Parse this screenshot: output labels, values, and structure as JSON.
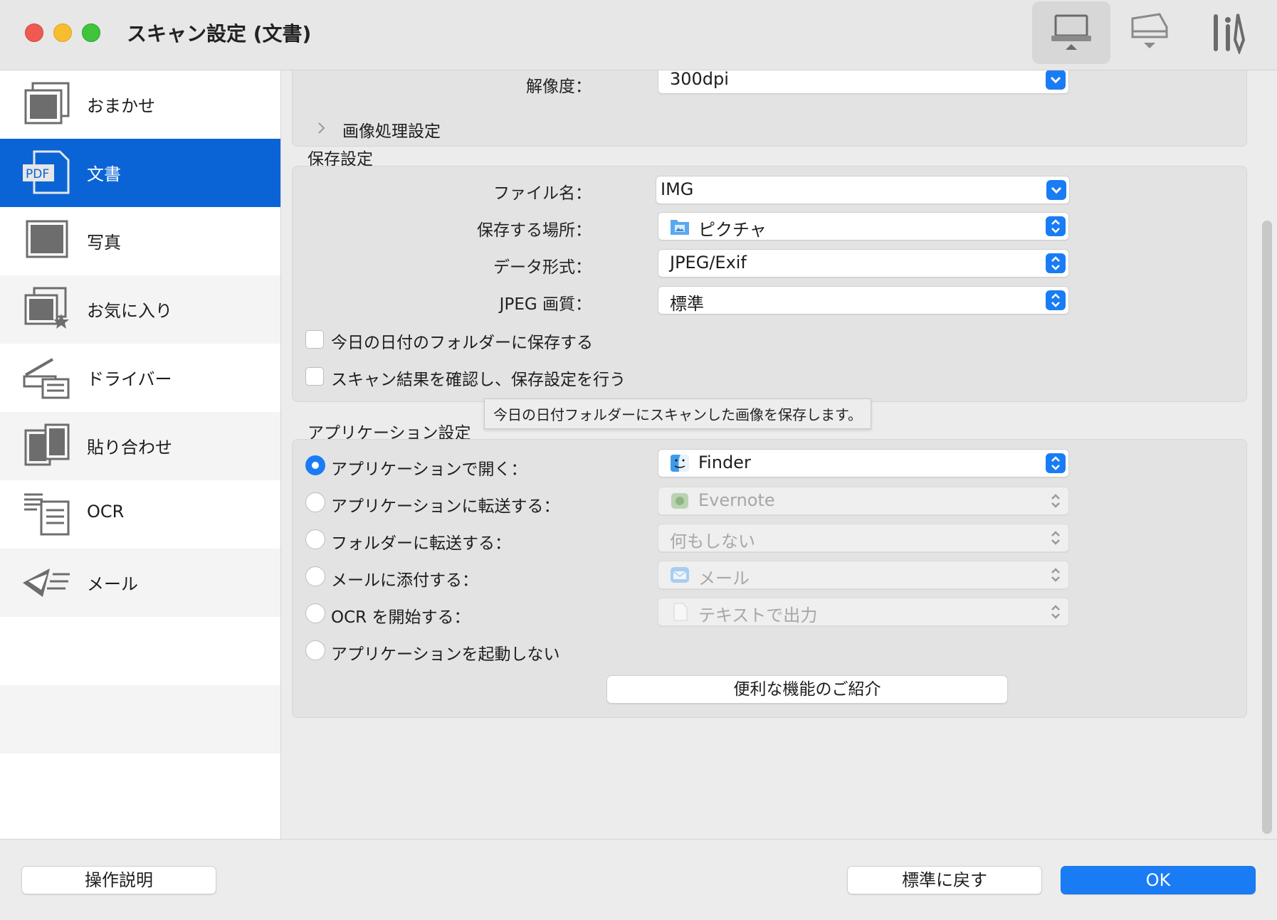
{
  "window": {
    "title": "スキャン設定 (文書)"
  },
  "toolbar": {
    "icons": [
      "computer-scan-icon",
      "scanner-scan-icon",
      "general-settings-icon"
    ]
  },
  "sidebar": {
    "items": [
      {
        "label": "おまかせ",
        "icon": "auto-scan-icon"
      },
      {
        "label": "文書",
        "icon": "pdf-document-icon",
        "selected": true
      },
      {
        "label": "写真",
        "icon": "photo-icon"
      },
      {
        "label": "お気に入り",
        "icon": "favorites-icon"
      },
      {
        "label": "ドライバー",
        "icon": "driver-icon"
      },
      {
        "label": "貼り合わせ",
        "icon": "stitch-icon"
      },
      {
        "label": "OCR",
        "icon": "ocr-icon"
      },
      {
        "label": "メール",
        "icon": "mail-icon"
      }
    ]
  },
  "scan_options": {
    "resolution_label": "解像度：",
    "resolution_value": "300dpi",
    "image_processing_label": "画像処理設定"
  },
  "save_settings": {
    "title": "保存設定",
    "file_name_label": "ファイル名：",
    "file_name_value": "IMG",
    "location_label": "保存する場所：",
    "location_value": "ピクチャ",
    "format_label": "データ形式：",
    "format_value": "JPEG/Exif",
    "jpeg_quality_label": "JPEG 画質：",
    "jpeg_quality_value": "標準",
    "date_folder_label": "今日の日付のフォルダーに保存する",
    "confirm_label": "スキャン結果を確認し、保存設定を行う",
    "tooltip": "今日の日付フォルダーにスキャンした画像を保存します。"
  },
  "app_settings": {
    "title": "アプリケーション設定",
    "options": [
      {
        "label": "アプリケーションで開く：",
        "value": "Finder",
        "selected": true,
        "enabled": true
      },
      {
        "label": "アプリケーションに転送する：",
        "value": "Evernote",
        "selected": false,
        "enabled": false
      },
      {
        "label": "フォルダーに転送する：",
        "value": "何もしない",
        "selected": false,
        "enabled": false
      },
      {
        "label": "メールに添付する：",
        "value": "メール",
        "selected": false,
        "enabled": false
      },
      {
        "label": "OCR を開始する：",
        "value": "テキストで出力",
        "selected": false,
        "enabled": false
      },
      {
        "label": "アプリケーションを起動しない",
        "selected": false
      }
    ],
    "features_button": "便利な機能のご紹介"
  },
  "footer": {
    "instructions_button": "操作説明",
    "defaults_button": "標準に戻す",
    "ok_button": "OK"
  },
  "colors": {
    "accent": "#1a7cf5",
    "sidebar_selected": "#0a64d6"
  }
}
